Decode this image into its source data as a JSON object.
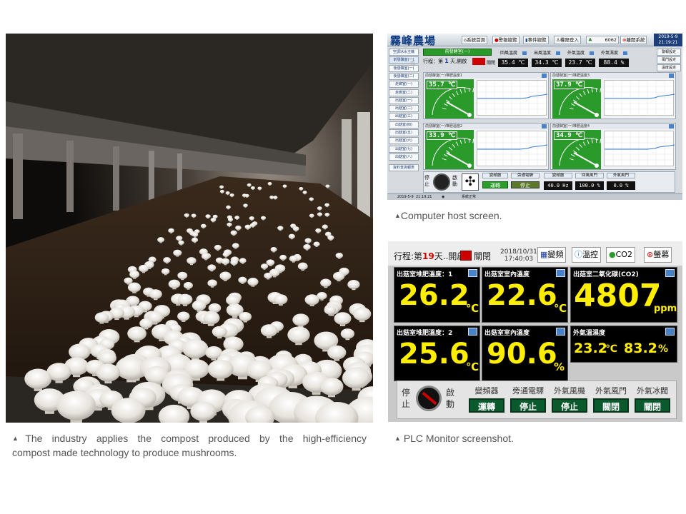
{
  "captions": {
    "host": "Computer host screen.",
    "photo_line1": "The industry applies the compost produced by the high-efficiency",
    "photo_line2": "compost made technology to produce mushrooms.",
    "plc": "PLC Monitor screenshot."
  },
  "host_screen": {
    "title": "霧峰農場",
    "header_buttons": [
      "系統首頁",
      "警報總覽",
      "事件總覽",
      "權限登入",
      "6062",
      "離開系統"
    ],
    "date": "2019-5-9",
    "time": "21:19:21",
    "nav_items": [
      "空調冰水主機",
      "前發酵室(一)",
      "後發酵室(一)",
      "後發酵室(二)",
      "走廊室(一)",
      "走廊室(二)",
      "出菇室(一)",
      "出菇室(二)",
      "出菇室(三)",
      "出菇室(四)",
      "出菇室(五)",
      "出菇室(六)",
      "出菇室(七)",
      "出菇室(八)",
      "資料查詢報表"
    ],
    "room_title": "前發酵室(一)",
    "progress_text": "行程：第",
    "progress_day": "1",
    "progress_suffix": "天,開啟",
    "close_label": "關閉",
    "readings": [
      {
        "label": "回風溫度",
        "value": "35.4 ℃"
      },
      {
        "label": "出風溫度",
        "value": "34.3 ℃"
      },
      {
        "label": "外氣溫度",
        "value": "23.7 ℃"
      },
      {
        "label": "外氣濕度",
        "value": "88.4 %"
      }
    ],
    "side_buttons": [
      "警報設定",
      "風門設定",
      "溫度設定"
    ],
    "panels": [
      {
        "title": "前發酵室(一)堆肥溫度1",
        "value": "35.7 ℃"
      },
      {
        "title": "前發酵室(一)堆肥溫度3",
        "value": "37.9 ℃"
      },
      {
        "title": "前發酵室(一)堆肥溫度2",
        "value": "33.9 ℃"
      },
      {
        "title": "前發酵室(一)堆肥溫度4",
        "value": "34.9 ℃"
      }
    ],
    "bottom": {
      "stop": "停止",
      "start": "啟動",
      "inverter_label": "變頻器",
      "inverter_value": "運轉",
      "bypass_label": "旁通電驛",
      "bypass_value": "停止",
      "freq_label": "變頻器",
      "freq_value": "40.0 Hz",
      "return_damper_label": "回風風門",
      "return_damper_value": "100.0 %",
      "outside_damper_label": "外氣風門",
      "outside_damper_value": "0.0 %"
    },
    "status_date": "2019-5-9",
    "status_time": "21:19:21",
    "status_text": "系統正常"
  },
  "plc_screen": {
    "progress_prefix": "行程:第",
    "progress_day": "19",
    "progress_suffix": "天..開啟",
    "close_label": "關閉",
    "date": "2018/10/31",
    "time": "17:40:03",
    "header_buttons": [
      "變頻",
      "溫控",
      "CO2",
      "螢幕"
    ],
    "tiles": [
      {
        "label": "出菇室堆肥溫度：1",
        "value": "26.2",
        "unit": "℃"
      },
      {
        "label": "出菇室室內溫度",
        "value": "22.6",
        "unit": "℃"
      },
      {
        "label": "出菇室二氧化碳(CO2)",
        "value": "4807",
        "unit": "ppm"
      },
      {
        "label": "出菇室堆肥溫度：2",
        "value": "25.6",
        "unit": "℃"
      },
      {
        "label": "出菇室室內溫度",
        "value": "90.6",
        "unit": "%"
      },
      {
        "label": "外氣溫濕度",
        "value": "23.2",
        "unit": "℃",
        "value2": "83.2",
        "unit2": "%"
      }
    ],
    "stop": "停止",
    "start": "啟動",
    "controls": [
      {
        "label": "變頻器",
        "value": "運轉"
      },
      {
        "label": "旁通電驛",
        "value": "停止"
      },
      {
        "label": "外氣風機",
        "value": "停止"
      },
      {
        "label": "外氣風門",
        "value": "關閉"
      },
      {
        "label": "外氣冰閥",
        "value": "關閉"
      }
    ]
  },
  "colors": {
    "gauge_green": "#2a9a2a",
    "plc_value_yellow": "#ffee00",
    "plc_button_green": "#0b5a2e",
    "host_logo_blue": "#0d3a82"
  }
}
